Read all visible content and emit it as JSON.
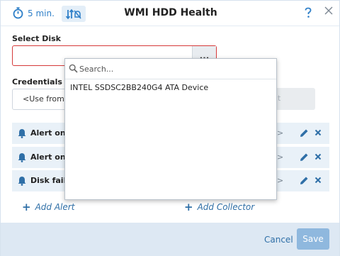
{
  "header": {
    "interval": "5 min.",
    "title": "WMI HDD Health"
  },
  "select_disk": {
    "label": "Select Disk",
    "value": "",
    "more_label": "..."
  },
  "credentials": {
    "label": "Credentials",
    "value": "<Use from V",
    "edit_label": "it"
  },
  "alerts": [
    {
      "label": "Alert on a",
      "chevron": ">"
    },
    {
      "label": "Alert on c",
      "chevron": ">"
    },
    {
      "label": "Disk failu",
      "chevron": ">"
    }
  ],
  "links": {
    "add_alert": "Add Alert",
    "add_collector": "Add Collector"
  },
  "footer": {
    "cancel": "Cancel",
    "save": "Save"
  },
  "dropdown": {
    "placeholder": "Search...",
    "items": [
      "INTEL SSDSC2BB240G4 ATA Device"
    ]
  },
  "colors": {
    "accent": "#2e7fc8",
    "error_border": "#d63a3a",
    "row_bg": "#e9f1f8",
    "footer_bg": "#dde8f3",
    "save_bg": "#8fb8de"
  },
  "icons": [
    "stopwatch-icon",
    "notifications-off-icon",
    "help-icon",
    "close-icon",
    "bell-icon",
    "pencil-icon",
    "delete-icon",
    "search-icon",
    "plus-icon"
  ]
}
